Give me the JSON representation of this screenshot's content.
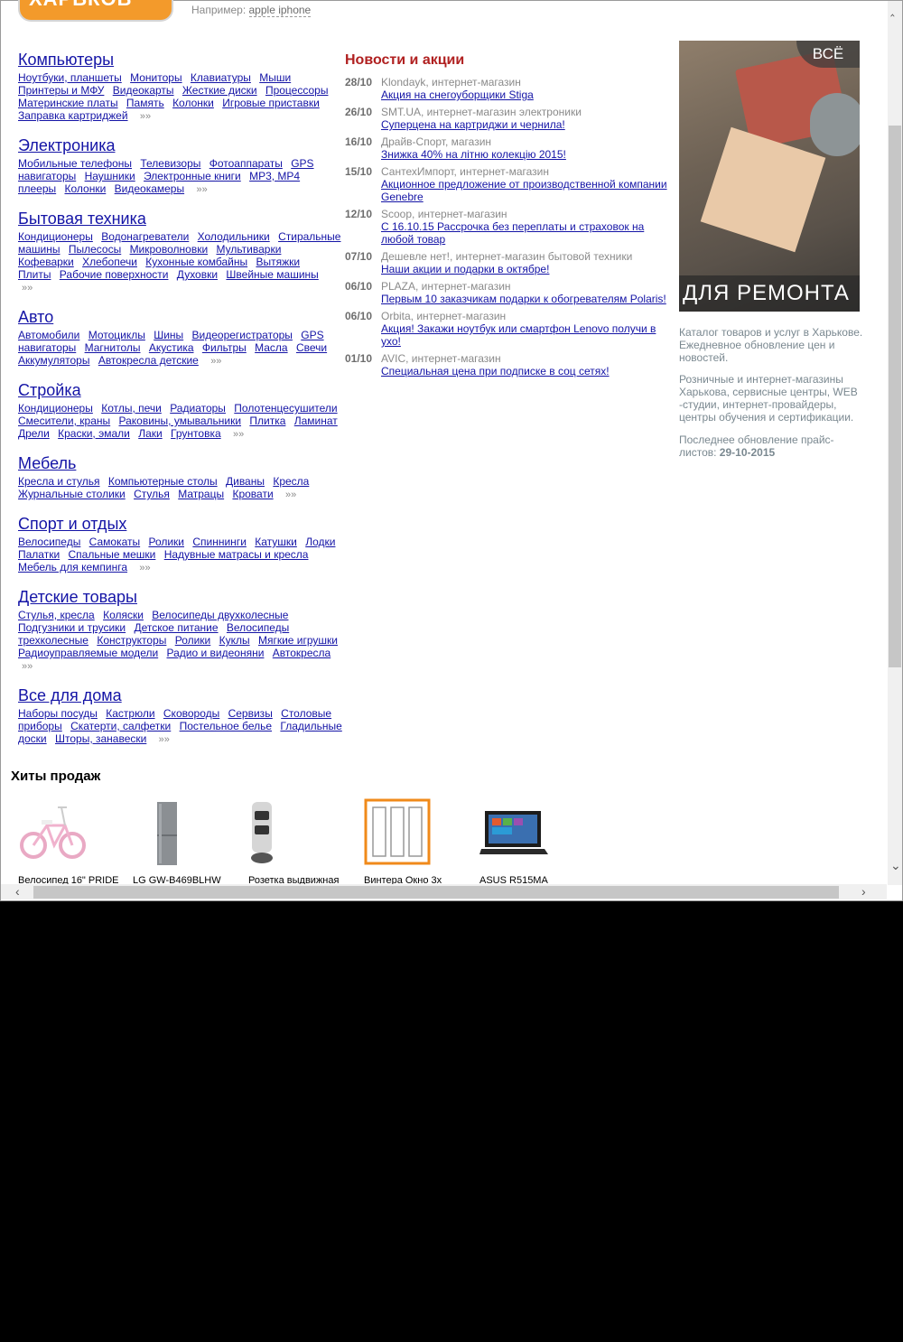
{
  "header": {
    "logo_text": "ХАРЬКОВ",
    "search_hint_prefix": "Например:",
    "search_hint_example": "apple iphone"
  },
  "catalog": [
    {
      "title": "Компьютеры",
      "links": [
        "Ноутбуки, планшеты",
        "Мониторы",
        "Клавиатуры",
        "Мыши",
        "Принтеры и МФУ",
        "Видеокарты",
        "Жесткие диски",
        "Процессоры",
        "Материнские платы",
        "Память",
        "Колонки",
        "Игровые приставки",
        "Заправка картриджей"
      ]
    },
    {
      "title": "Электроника",
      "links": [
        "Мобильные телефоны",
        "Телевизоры",
        "Фотоаппараты",
        "GPS навигаторы",
        "Наушники",
        "Электронные книги",
        "MP3, MP4 плееры",
        "Колонки",
        "Видеокамеры"
      ]
    },
    {
      "title": "Бытовая техника",
      "links": [
        "Кондиционеры",
        "Водонагреватели",
        "Холодильники",
        "Стиральные машины",
        "Пылесосы",
        "Микроволновки",
        "Мультиварки",
        "Кофеварки",
        "Хлебопечи",
        "Кухонные комбайны",
        "Вытяжки",
        "Плиты",
        "Рабочие поверхности",
        "Духовки",
        "Швейные машины"
      ]
    },
    {
      "title": "Авто",
      "links": [
        "Автомобили",
        "Мотоциклы",
        "Шины",
        "Видеорегистраторы",
        "GPS навигаторы",
        "Магнитолы",
        "Акустика",
        "Фильтры",
        "Масла",
        "Свечи",
        "Аккумуляторы",
        "Автокресла детские"
      ]
    },
    {
      "title": "Стройка",
      "links": [
        "Кондиционеры",
        "Котлы, печи",
        "Радиаторы",
        "Полотенцесушители",
        "Смесители, краны",
        "Раковины, умывальники",
        "Плитка",
        "Ламинат",
        "Дрели",
        "Краски, эмали",
        "Лаки",
        "Грунтовка"
      ]
    },
    {
      "title": "Мебель",
      "links": [
        "Кресла и стулья",
        "Компьютерные столы",
        "Диваны",
        "Кресла",
        "Журнальные столики",
        "Стулья",
        "Матрацы",
        "Кровати"
      ]
    },
    {
      "title": "Спорт и отдых",
      "links": [
        "Велосипеды",
        "Самокаты",
        "Ролики",
        "Спиннинги",
        "Катушки",
        "Лодки",
        "Палатки",
        "Спальные мешки",
        "Надувные матрасы и кресла",
        "Мебель для кемпинга"
      ]
    },
    {
      "title": "Детские товары",
      "links": [
        "Стулья, кресла",
        "Коляски",
        "Велосипеды двухколесные",
        "Подгузники и трусики",
        "Детское питание",
        "Велосипеды трехколесные",
        "Конструкторы",
        "Ролики",
        "Куклы",
        "Мягкие игрушки",
        "Радиоуправляемые модели",
        "Радио и видеоняни",
        "Автокресла"
      ]
    },
    {
      "title": "Все для дома",
      "links": [
        "Наборы посуды",
        "Кастрюли",
        "Сковороды",
        "Сервизы",
        "Столовые приборы",
        "Скатерти, салфетки",
        "Постельное белье",
        "Гладильные доски",
        "Шторы, занавески"
      ]
    }
  ],
  "more_label": "»»",
  "news": {
    "title": "Новости и акции",
    "items": [
      {
        "date": "28/10",
        "source": "Klondayk, интернет-магазин",
        "text": "Акция на снегоуборщики Stiga"
      },
      {
        "date": "26/10",
        "source": "SMT.UA, интернет-магазин электроники",
        "text": "Суперцена на картриджи и чернила!"
      },
      {
        "date": "16/10",
        "source": "Драйв-Спорт, магазин",
        "text": "Знижка 40% на літню колекцію 2015!"
      },
      {
        "date": "15/10",
        "source": "СантехИмпорт, интернет-магазин",
        "text": "Акционное предложение от производственной компании Genebre"
      },
      {
        "date": "12/10",
        "source": "Scoop, интернет-магазин",
        "text": "С 16.10.15 Рассрочка без переплаты и страховок на любой товар"
      },
      {
        "date": "07/10",
        "source": "Дешевле нет!, интернет-магазин бытовой техники",
        "text": "Наши акции и подарки в октябре!"
      },
      {
        "date": "06/10",
        "source": "PLAZA, интернет-магазин",
        "text": "Первым 10 заказчикам подарки к обогревателям Polaris!"
      },
      {
        "date": "06/10",
        "source": "Orbita, интернет-магазин",
        "text": "Акция! Закажи ноутбук или смартфон Lenovo получи в ухо!"
      },
      {
        "date": "01/10",
        "source": "AVIC, интернет-магазин",
        "text": "Специальная цена при подписке в соц сетях!"
      }
    ]
  },
  "promo": {
    "top": "ВСЁ",
    "bottom": "ДЛЯ РЕМОНТА"
  },
  "sidebar": {
    "p1": "Каталог товаров и услуг в Харькове. Ежедневное обновление цен и новостей.",
    "p2": "Розничные и интернет-магазины Харькова, сервисные центры, WEB -студии, интернет-провайдеры, центры обучения и сертификации.",
    "p3_prefix": "Последнее обновление прайс-листов:",
    "p3_date": "29-10-2015"
  },
  "hits": {
    "title": "Хиты продаж",
    "items": [
      {
        "name": "Велосипед 16\" PRIDE",
        "icon": "bicycle-icon"
      },
      {
        "name": "LG GW-B469BLHW",
        "icon": "fridge-icon"
      },
      {
        "name": "Розетка выдвижная",
        "icon": "socket-icon"
      },
      {
        "name": "Винтера Окно 3х",
        "icon": "window-icon"
      },
      {
        "name": "ASUS R515MA",
        "icon": "laptop-icon"
      }
    ]
  },
  "colors": {
    "link": "#1414a6",
    "news_title": "#b02020",
    "logo": "#f39a2b"
  }
}
